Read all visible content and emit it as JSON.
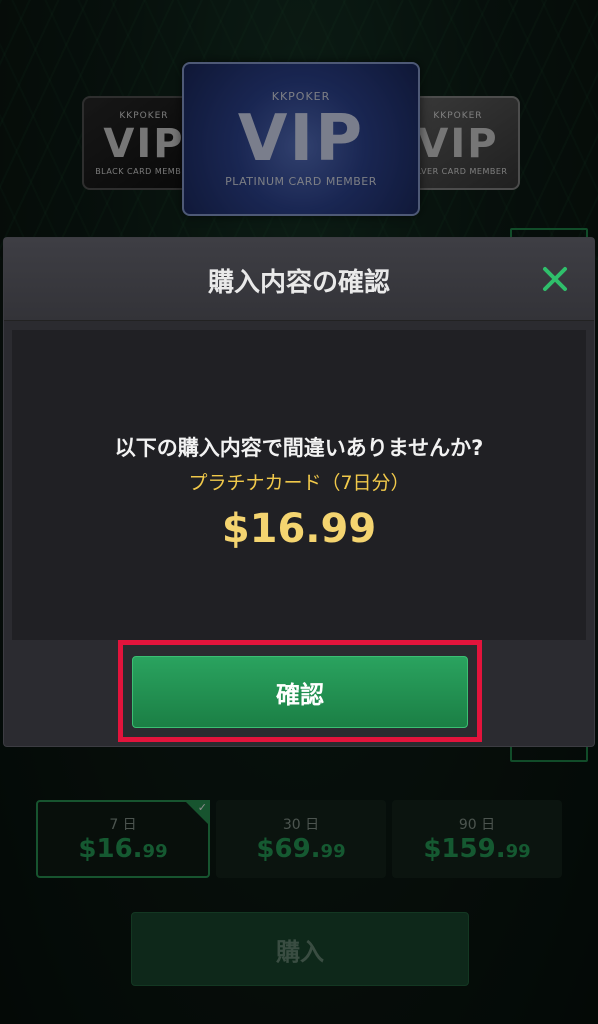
{
  "cards": {
    "black": {
      "brand": "KKPOKER",
      "vip": "VIP",
      "member": "BLACK CARD MEMBER"
    },
    "platinum": {
      "brand": "KKPOKER",
      "vip": "VIP",
      "member": "PLATINUM CARD MEMBER"
    },
    "silver": {
      "brand": "KKPOKER",
      "vip": "VIP",
      "member": "SILVER CARD MEMBER"
    }
  },
  "modal": {
    "title": "購入内容の確認",
    "question": "以下の購入内容で間違いありませんか?",
    "product": "プラチナカード（7日分）",
    "price": "$16.99",
    "confirm_label": "確認",
    "close_icon": "close-icon"
  },
  "plans": [
    {
      "days": "7 日",
      "price_main": "$16.",
      "price_cents": "99"
    },
    {
      "days": "30 日",
      "price_main": "$69.",
      "price_cents": "99"
    },
    {
      "days": "90 日",
      "price_main": "$159.",
      "price_cents": "99"
    }
  ],
  "buy_label": "購入",
  "colors": {
    "accent_green": "#27a25a",
    "price_gold": "#f4d470",
    "highlight_red": "#e3143c"
  }
}
